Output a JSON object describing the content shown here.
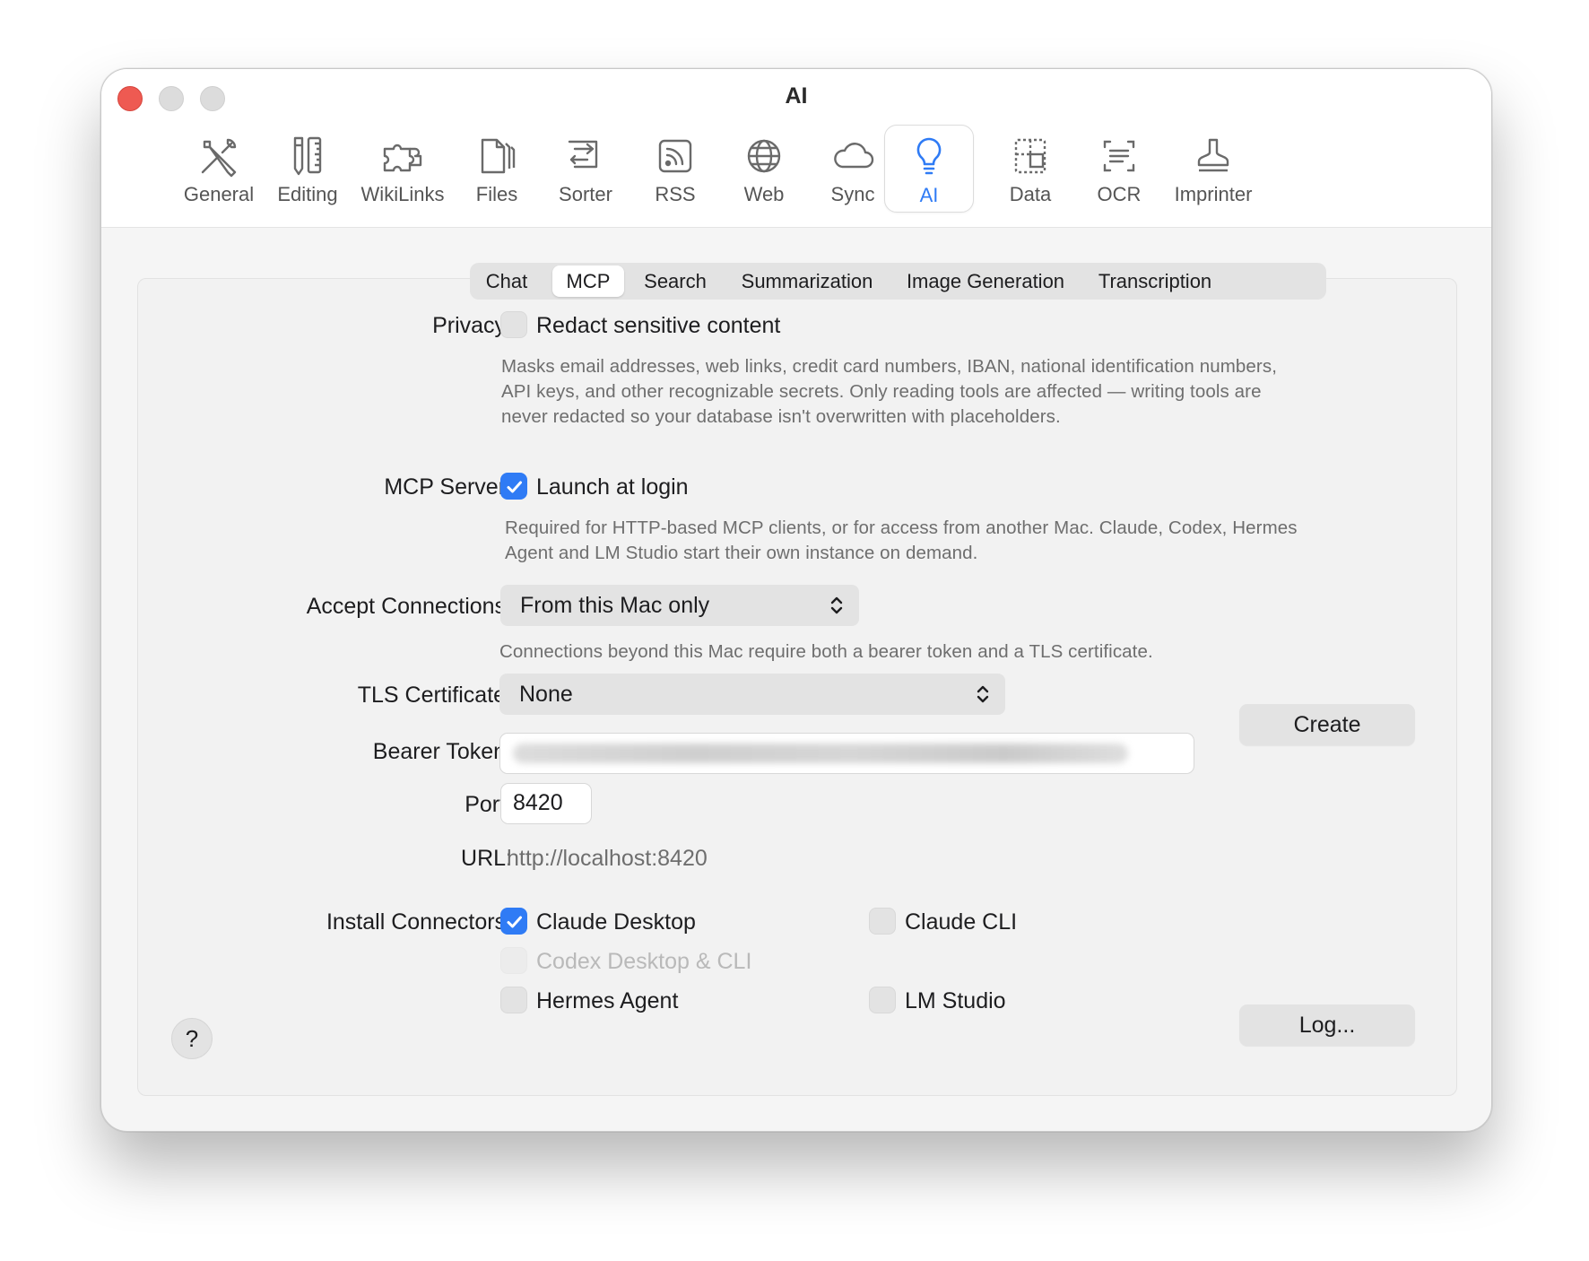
{
  "window": {
    "title": "AI"
  },
  "toolbar": {
    "items": [
      {
        "label": "General",
        "icon": "general-tools-icon"
      },
      {
        "label": "Editing",
        "icon": "editing-pencil-ruler-icon"
      },
      {
        "label": "WikiLinks",
        "icon": "wikilinks-puzzle-icon"
      },
      {
        "label": "Files",
        "icon": "files-icon"
      },
      {
        "label": "Sorter",
        "icon": "sorter-icon"
      },
      {
        "label": "RSS",
        "icon": "rss-icon"
      },
      {
        "label": "Web",
        "icon": "globe-icon"
      },
      {
        "label": "Sync",
        "icon": "cloud-icon"
      },
      {
        "label": "AI",
        "icon": "lightbulb-icon",
        "selected": true
      },
      {
        "label": "Data",
        "icon": "data-icon"
      },
      {
        "label": "OCR",
        "icon": "ocr-icon"
      },
      {
        "label": "Imprinter",
        "icon": "stamp-icon"
      }
    ],
    "accent": "#2f7bf5"
  },
  "tabs": {
    "items": [
      "Chat",
      "MCP",
      "Search",
      "Summarization",
      "Image Generation",
      "Transcription"
    ],
    "selected": "MCP"
  },
  "privacy": {
    "label": "Privacy:",
    "checkbox_label": "Redact sensitive content",
    "checked": false,
    "help_lines": [
      "Masks email addresses, web links, credit card numbers, IBAN, national identification numbers,",
      "API keys, and other recognizable secrets. Only reading tools are affected — writing tools are",
      "never redacted so your database isn't overwritten with placeholders."
    ]
  },
  "mcp_server": {
    "label": "MCP Server:",
    "checkbox_label": "Launch at login",
    "checked": true,
    "help_lines": [
      "Required for HTTP-based MCP clients, or for access from another Mac. Claude, Codex, Hermes",
      "Agent and LM Studio start their own instance on demand."
    ]
  },
  "accept_connections": {
    "label": "Accept Connections:",
    "value": "From this Mac only",
    "help": "Connections beyond this Mac require both a bearer token and a TLS certificate."
  },
  "tls_certificate": {
    "label": "TLS Certificate:",
    "value": "None",
    "create_button": "Create"
  },
  "bearer_token": {
    "label": "Bearer Token:",
    "value": ""
  },
  "port": {
    "label": "Port:",
    "value": "8420"
  },
  "url": {
    "label": "URL:",
    "value": "http://localhost:8420"
  },
  "connectors": {
    "label": "Install Connectors:",
    "items": [
      {
        "label": "Claude Desktop",
        "checked": true,
        "enabled": true
      },
      {
        "label": "Claude CLI",
        "checked": false,
        "enabled": true
      },
      {
        "label": "Codex Desktop & CLI",
        "checked": false,
        "enabled": false
      },
      {
        "label": "Hermes Agent",
        "checked": false,
        "enabled": true
      },
      {
        "label": "LM Studio",
        "checked": false,
        "enabled": true
      }
    ]
  },
  "footer": {
    "help_button": "?",
    "log_button": "Log..."
  }
}
